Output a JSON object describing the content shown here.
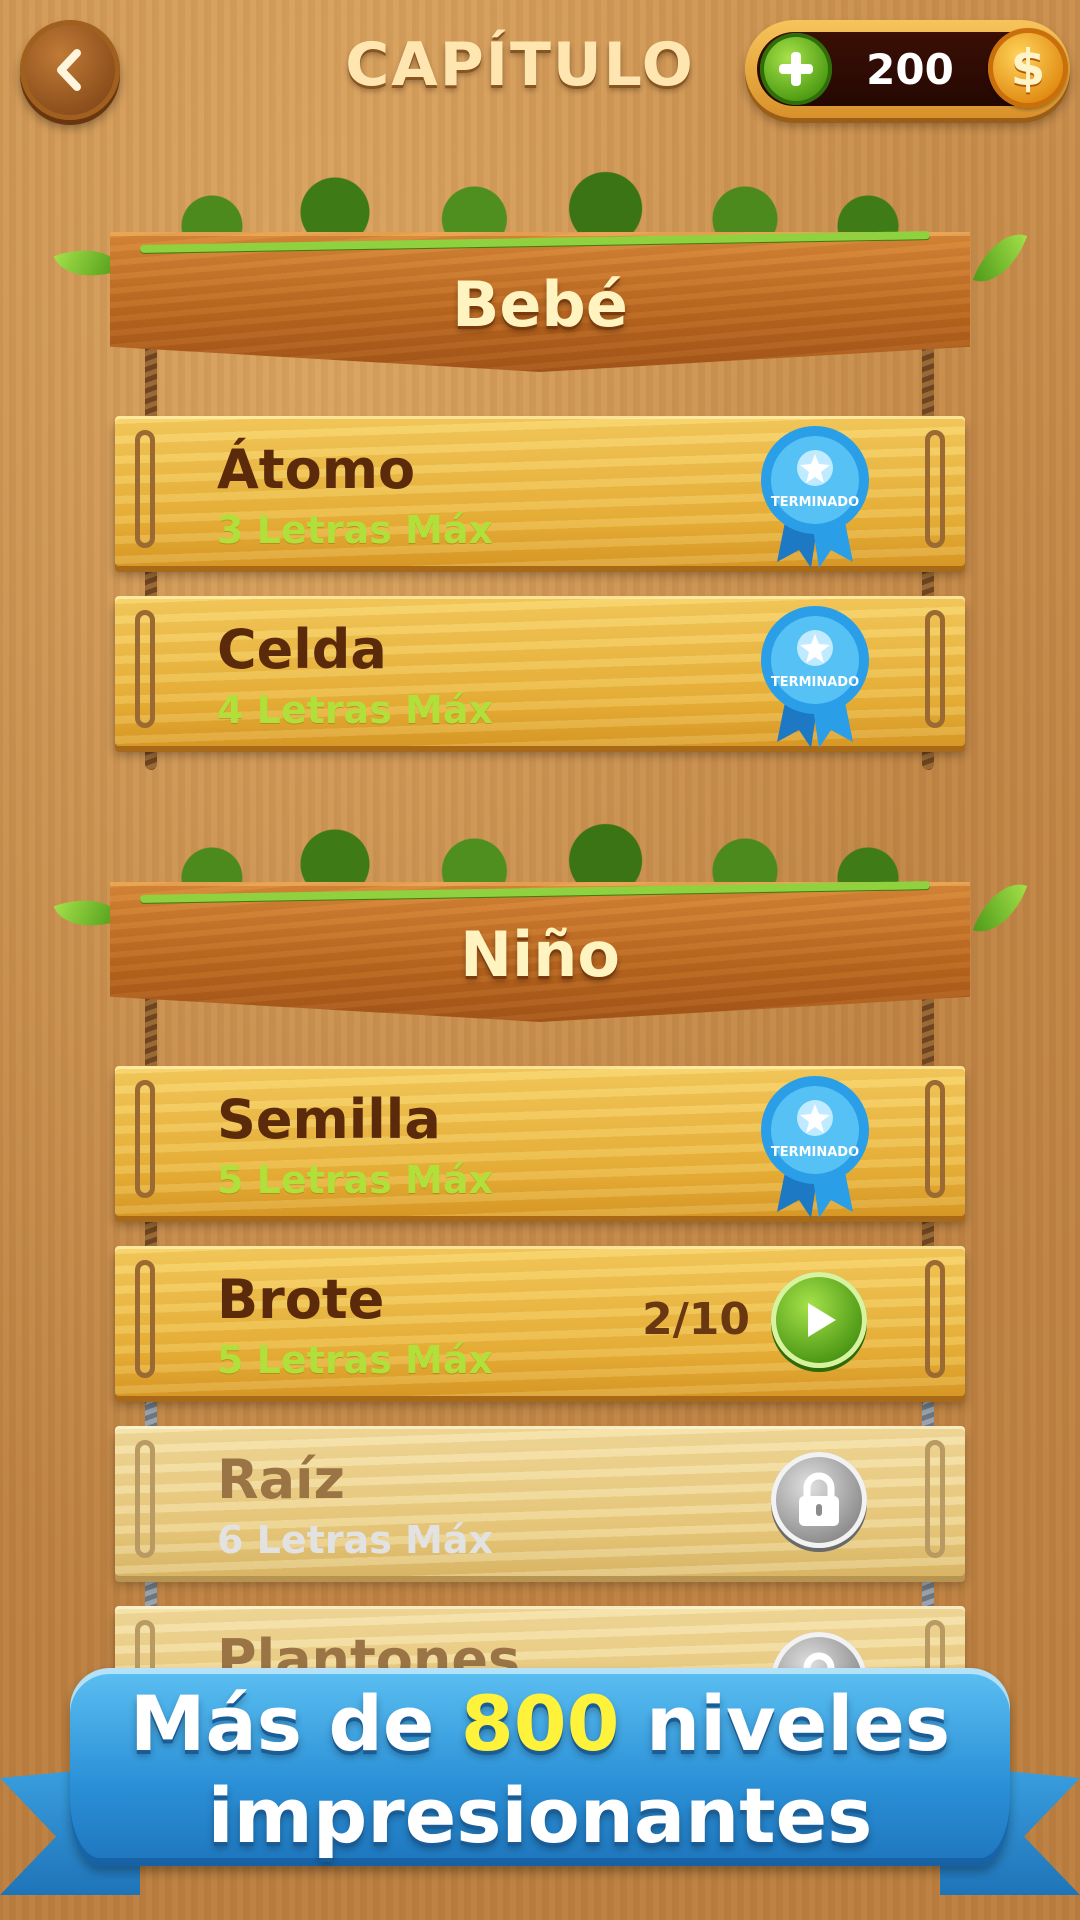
{
  "header": {
    "title": "CAPÍTULO",
    "coins": "200",
    "coin_symbol": "$"
  },
  "chapters": [
    {
      "title": "Bebé",
      "levels": [
        {
          "name": "Átomo",
          "sub": "3 Letras Máx",
          "status": "TERMINADO"
        },
        {
          "name": "Celda",
          "sub": "4 Letras Máx",
          "status": "TERMINADO"
        }
      ]
    },
    {
      "title": "Niño",
      "levels": [
        {
          "name": "Semilla",
          "sub": "5 Letras Máx",
          "status": "TERMINADO"
        },
        {
          "name": "Brote",
          "sub": "5 Letras Máx",
          "progress": "2/10"
        },
        {
          "name": "Raíz",
          "sub": "6 Letras Máx"
        },
        {
          "name": "Plantones"
        }
      ]
    }
  ],
  "promo": {
    "line1_a": "Más de ",
    "line1_num": "800",
    "line1_b": " niveles",
    "line2": "impresionantes"
  },
  "colors": {
    "badge_blue": "#2a9ee6",
    "sub_green": "#b2e03a",
    "play_green": "#4a9614",
    "lock_gray": "#8c8c8c",
    "promo_yellow": "#fff23a"
  },
  "icons": {
    "back": "chevron-left-icon",
    "plus": "plus-icon",
    "coin": "dollar-coin-icon",
    "completed": "ribbon-badge-icon",
    "play": "play-icon",
    "lock": "lock-icon"
  }
}
